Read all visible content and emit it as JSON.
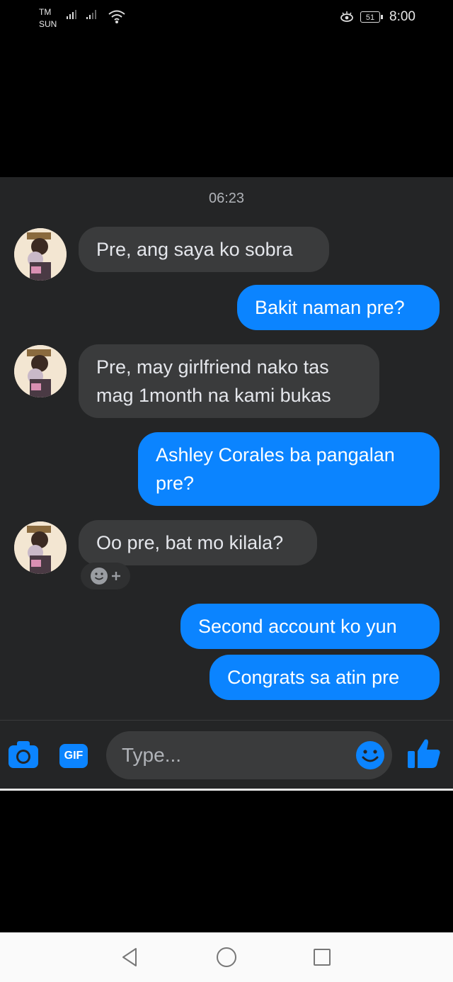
{
  "status_bar": {
    "carrier1": "TM",
    "carrier2": "SUN",
    "battery": "51",
    "time": "8:00"
  },
  "chat": {
    "timestamp": "06:23",
    "messages": [
      {
        "side": "in",
        "text_lines": [
          "Pre, ang saya ko sobra"
        ]
      },
      {
        "side": "out",
        "text_lines": [
          "Bakit naman pre?"
        ]
      },
      {
        "side": "in",
        "text_lines": [
          "Pre, may girlfriend nako tas",
          "mag 1month na kami bukas"
        ]
      },
      {
        "side": "out",
        "text_lines": [
          "Ashley Corales ba pangalan",
          "pre?"
        ]
      },
      {
        "side": "in",
        "text_lines": [
          "Oo pre, bat mo kilala?"
        ]
      },
      {
        "side": "out",
        "text_lines": [
          "Second account ko yun"
        ]
      },
      {
        "side": "out",
        "text_lines": [
          "Congrats sa atin pre"
        ]
      }
    ]
  },
  "composer": {
    "gif_label": "GIF",
    "placeholder": "Type...",
    "icons": [
      "camera-icon",
      "gif-icon",
      "emoji-icon",
      "thumbs-up-icon"
    ]
  },
  "nav": {
    "icons": [
      "back-icon",
      "home-icon",
      "recents-icon"
    ]
  },
  "colors": {
    "outgoing": "#0b84ff",
    "incoming": "#3a3b3c",
    "chat_bg": "#242526"
  }
}
